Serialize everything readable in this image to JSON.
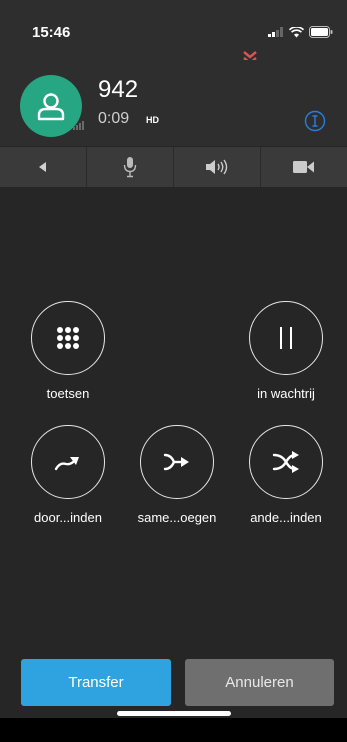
{
  "status_bar": {
    "time": "15:46"
  },
  "call": {
    "number": "942",
    "duration": "0:09",
    "hd_badge": "HD",
    "avatar_color": "#26a682"
  },
  "controls": [
    {
      "name": "back",
      "icon": "back-arrow-icon"
    },
    {
      "name": "mute",
      "icon": "microphone-icon"
    },
    {
      "name": "speaker",
      "icon": "speaker-icon"
    },
    {
      "name": "video",
      "icon": "video-camera-icon"
    }
  ],
  "actions": {
    "keypad": "toetsen",
    "hold": "in wachtrij",
    "forward": "door...inden",
    "merge": "same...oegen",
    "swap": "ande...inden"
  },
  "buttons": {
    "transfer": "Transfer",
    "cancel": "Annuleren"
  },
  "colors": {
    "accent": "#2fa3e0",
    "cancel": "#6f6f6f",
    "info": "#2a7de1"
  }
}
